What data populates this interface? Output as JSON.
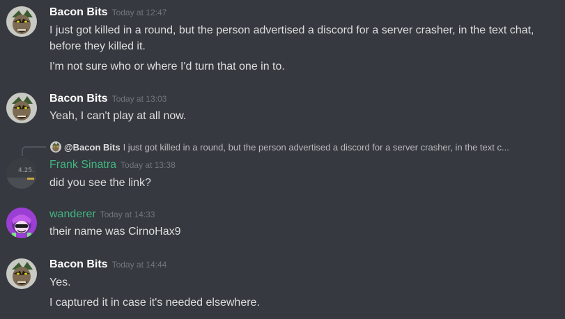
{
  "colors": {
    "background": "#36393f",
    "username_default": "#ffffff",
    "username_green": "#43b581",
    "timestamp": "#72767d",
    "text": "#dcddde"
  },
  "messages": [
    {
      "username": "Bacon Bits",
      "timestamp": "Today at 12:47",
      "avatar_icon": "bacon-bits-avatar-icon",
      "lines": [
        "I just got killed in a round, but the person advertised a discord for a server crasher, in the text chat,",
        "before they killed it.",
        "I'm not sure who or where I'd turn that one in to."
      ]
    },
    {
      "username": "Bacon Bits",
      "timestamp": "Today at 13:03",
      "avatar_icon": "bacon-bits-avatar-icon",
      "lines": [
        "Yeah, I can't play at all now."
      ]
    },
    {
      "reply": {
        "mention": "@Bacon Bits",
        "preview": "I just got killed in a round, but the person advertised a discord for a server crasher, in the text c..."
      },
      "username": "Frank Sinatra",
      "timestamp": "Today at 13:38",
      "avatar_icon": "frank-sinatra-avatar-icon",
      "avatar_text": "4.25.",
      "lines": [
        "did you see the link?"
      ]
    },
    {
      "username": "wanderer",
      "timestamp": "Today at 14:33",
      "avatar_icon": "wanderer-avatar-icon",
      "lines": [
        "their name was CirnoHax9"
      ]
    },
    {
      "username": "Bacon Bits",
      "timestamp": "Today at 14:44",
      "avatar_icon": "bacon-bits-avatar-icon",
      "lines": [
        "Yes.",
        "I captured it in case it's needed elsewhere."
      ]
    }
  ]
}
